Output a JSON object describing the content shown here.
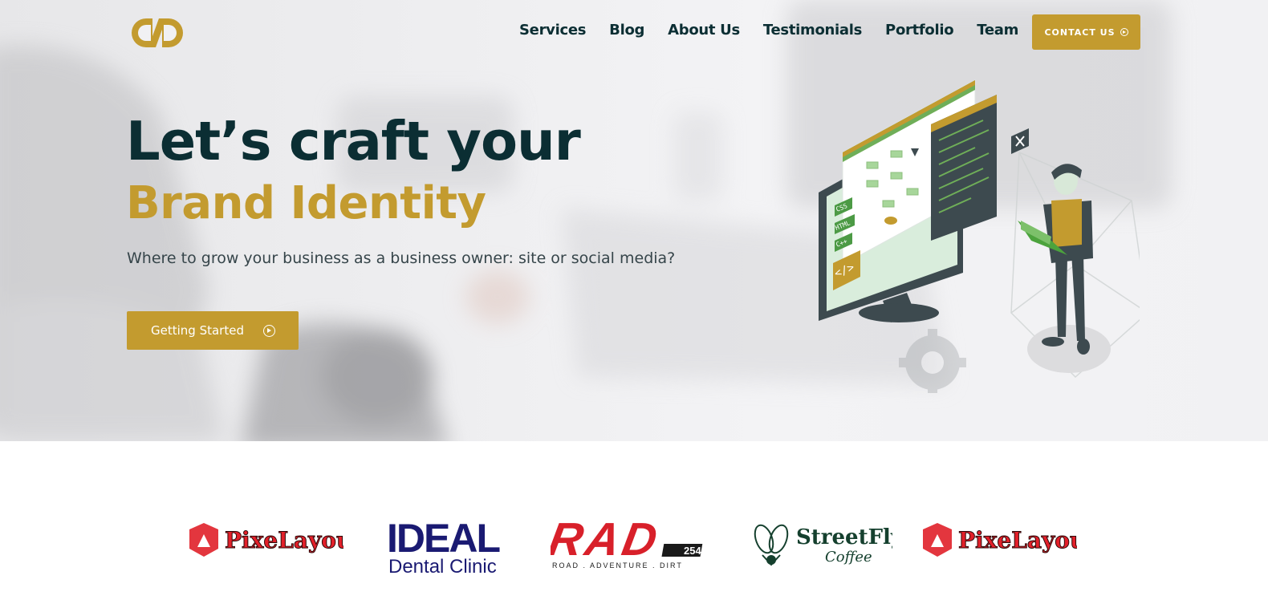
{
  "brand": {
    "logo_icon": "cd-monogram-logo",
    "accent_color": "#c39b2f",
    "dark_color": "#0b2e33"
  },
  "nav": {
    "items": [
      {
        "label": "Services"
      },
      {
        "label": "Blog"
      },
      {
        "label": "About Us"
      },
      {
        "label": "Testimonials"
      },
      {
        "label": "Portfolio"
      },
      {
        "label": "Team"
      }
    ],
    "contact_label": "CONTACT US",
    "contact_icon": "arrow-circle-right-icon"
  },
  "hero": {
    "headline_line1": "Let’s craft your",
    "headline_line2": "Brand Identity",
    "subtitle": "Where to grow your business as a business owner: site or social media?",
    "cta_label": "Getting Started",
    "cta_icon": "arrow-circle-right-icon",
    "illustration": {
      "tags": [
        "CSS",
        "HTML",
        "C++"
      ],
      "icon": "web-developer-illustration"
    }
  },
  "clients": [
    {
      "name": "PixeLayout"
    },
    {
      "name": "IDEAL",
      "sub": "Dental Clinic"
    },
    {
      "name": "RAD",
      "badge": "254",
      "sub": "ROAD . ADVENTURE . DIRT"
    },
    {
      "name": "StreetFly",
      "sub": "Coffee"
    },
    {
      "name": "PixeLayout"
    }
  ]
}
